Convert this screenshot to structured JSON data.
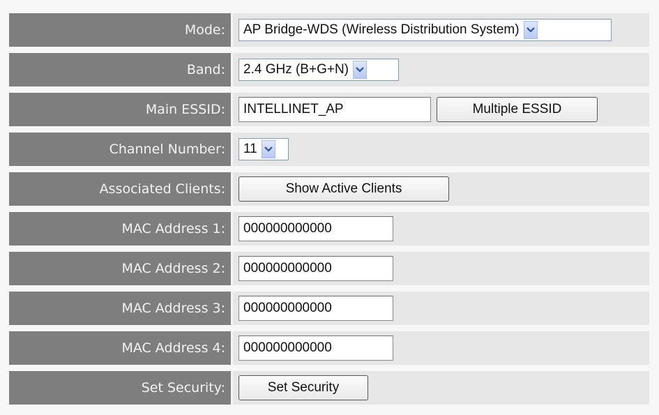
{
  "rows": [
    {
      "label": "Mode:",
      "value": "AP Bridge-WDS (Wireless Distribution System)"
    },
    {
      "label": "Band:",
      "value": "2.4 GHz (B+G+N)"
    },
    {
      "label": "Main ESSID:",
      "value": "INTELLINET_AP",
      "button": "Multiple ESSID"
    },
    {
      "label": "Channel Number:",
      "value": "11"
    },
    {
      "label": "Associated Clients:",
      "button": "Show Active Clients"
    },
    {
      "label": "MAC Address 1:",
      "value": "000000000000"
    },
    {
      "label": "MAC Address 2:",
      "value": "000000000000"
    },
    {
      "label": "MAC Address 3:",
      "value": "000000000000"
    },
    {
      "label": "MAC Address 4:",
      "value": "000000000000"
    },
    {
      "label": "Set Security:",
      "button": "Set Security"
    }
  ],
  "icons": {
    "dropdown": "chevron-down-icon"
  },
  "colors": {
    "label_bg": "#7e7e7e",
    "value_bg": "#e6e6e6",
    "select_border": "#7f9db9"
  }
}
